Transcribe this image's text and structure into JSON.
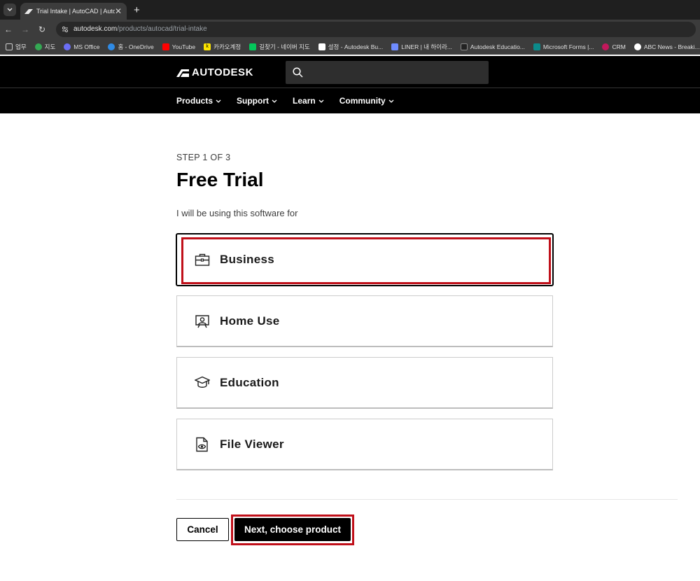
{
  "browser": {
    "tab_title": "Trial Intake | AutoCAD | Autodesk",
    "url_host": "autodesk.com",
    "url_path": "/products/autocad/trial-intake",
    "bookmarks": [
      {
        "label": "업무"
      },
      {
        "label": "지도"
      },
      {
        "label": "MS Office"
      },
      {
        "label": "홈 - OneDrive"
      },
      {
        "label": "YouTube"
      },
      {
        "label": "카카오계정"
      },
      {
        "label": "길찾기 - 네이버 지도"
      },
      {
        "label": "설정 - Autodesk Bu..."
      },
      {
        "label": "LINER | 내 하이라..."
      },
      {
        "label": "Autodesk Educatio..."
      },
      {
        "label": "Microsoft Forms |..."
      },
      {
        "label": "CRM"
      },
      {
        "label": "ABC News - Breaki..."
      }
    ]
  },
  "header": {
    "logo_text": "AUTODESK",
    "search_placeholder": ""
  },
  "nav": {
    "items": [
      {
        "label": "Products"
      },
      {
        "label": "Support"
      },
      {
        "label": "Learn"
      },
      {
        "label": "Community"
      }
    ]
  },
  "main": {
    "step": "STEP 1 OF 3",
    "title": "Free Trial",
    "question": "I will be using this software for",
    "options": [
      {
        "label": "Business",
        "icon": "briefcase-icon",
        "selected": true
      },
      {
        "label": "Home Use",
        "icon": "home-user-icon",
        "selected": false
      },
      {
        "label": "Education",
        "icon": "graduation-cap-icon",
        "selected": false
      },
      {
        "label": "File Viewer",
        "icon": "file-view-icon",
        "selected": false
      }
    ],
    "cancel_label": "Cancel",
    "next_label": "Next, choose product"
  },
  "colors": {
    "highlight": "#c0101a",
    "header_bg": "#000000",
    "primary_button": "#000000"
  }
}
